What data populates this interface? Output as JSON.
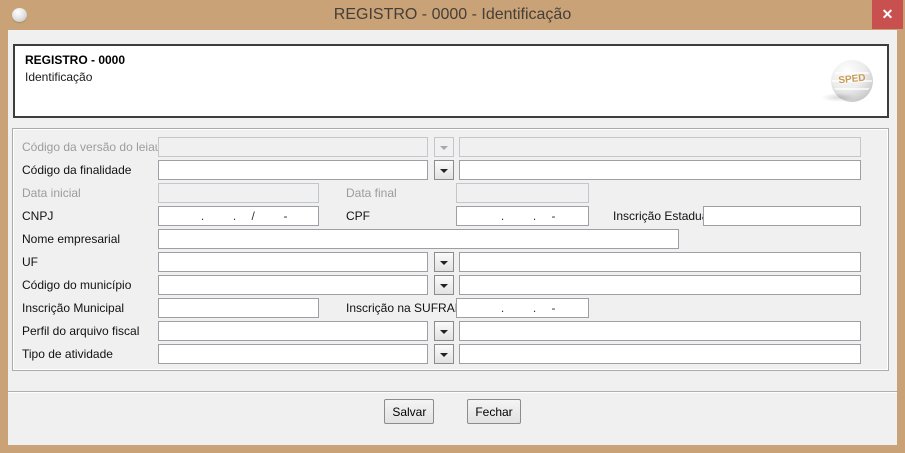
{
  "window": {
    "title": "REGISTRO - 0000 - Identificação",
    "close_glyph": "✕"
  },
  "header": {
    "title": "REGISTRO - 0000",
    "subtitle": "Identificação",
    "logo_text": "SPED"
  },
  "form": {
    "codigo_versao_leiaute": {
      "label": "Código da versão do leiaute",
      "value": "",
      "desc": ""
    },
    "codigo_finalidade": {
      "label": "Código da finalidade",
      "value": "",
      "desc": ""
    },
    "data_inicial": {
      "label": "Data inicial",
      "value": ""
    },
    "data_final": {
      "label": "Data final",
      "value": ""
    },
    "cnpj": {
      "label": "CNPJ",
      "value": " .  . /  -"
    },
    "cpf": {
      "label": "CPF",
      "value": " .  . -"
    },
    "inscricao_estadual": {
      "label": "Inscrição Estadual",
      "value": ""
    },
    "nome_empresarial": {
      "label": "Nome empresarial",
      "value": ""
    },
    "uf": {
      "label": "UF",
      "value": "",
      "desc": ""
    },
    "codigo_municipio": {
      "label": "Código do município",
      "value": "",
      "desc": ""
    },
    "inscricao_municipal": {
      "label": "Inscrição Municipal",
      "value": ""
    },
    "inscricao_suframa": {
      "label": "Inscrição na SUFRAMA",
      "value": " .  . -"
    },
    "perfil_arquivo_fiscal": {
      "label": "Perfil do arquivo fiscal",
      "value": "",
      "desc": ""
    },
    "tipo_atividade": {
      "label": "Tipo de atividade",
      "value": "",
      "desc": ""
    }
  },
  "footer": {
    "save_label": "Salvar",
    "close_label": "Fechar"
  },
  "colors": {
    "frame": "#C9A277",
    "close_button": "#C8504E",
    "client_bg": "#F0F0F0",
    "header_panel_bg": "#FFFFFF",
    "sped_logo_text": "#C99C55"
  }
}
